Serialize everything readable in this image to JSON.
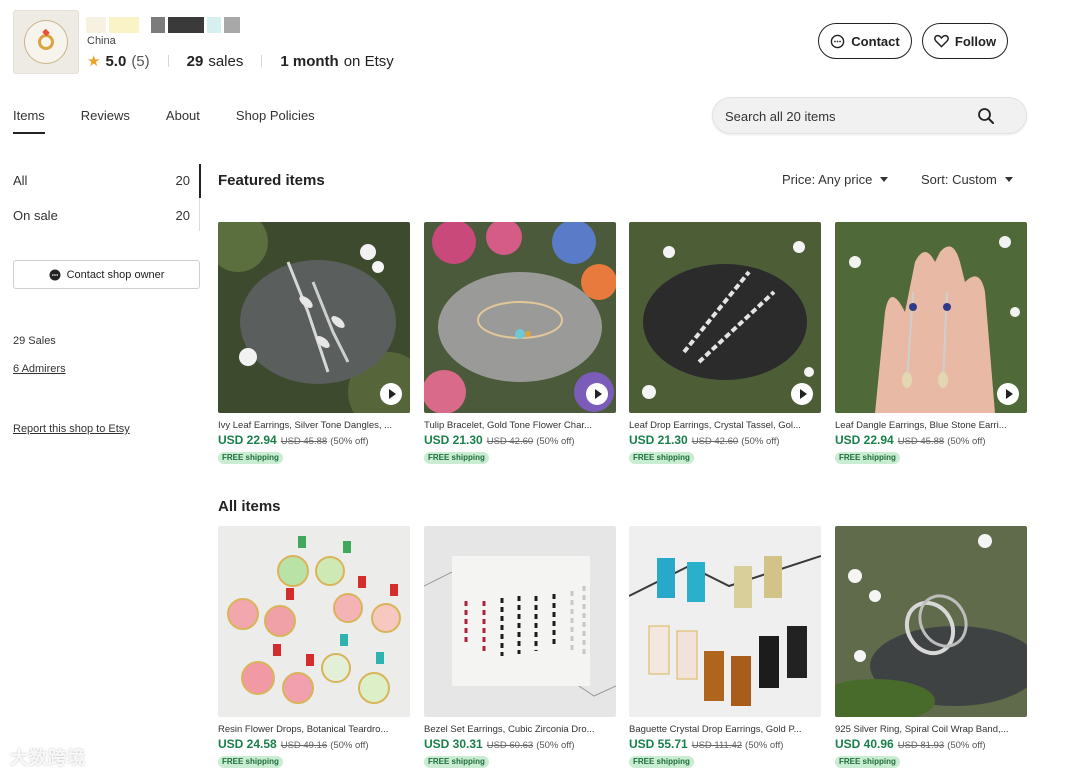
{
  "header": {
    "country": "China",
    "rating": "5.0",
    "rating_count": "(5)",
    "sales_count": "29",
    "sales_label": "sales",
    "tenure_strong": "1 month",
    "tenure_label": "on Etsy",
    "contact_label": "Contact",
    "follow_label": "Follow"
  },
  "tabs": [
    {
      "label": "Items",
      "active": true
    },
    {
      "label": "Reviews",
      "active": false
    },
    {
      "label": "About",
      "active": false
    },
    {
      "label": "Shop Policies",
      "active": false
    }
  ],
  "search": {
    "placeholder": "Search all 20 items"
  },
  "sidebar": {
    "filters": [
      {
        "label": "All",
        "count": "20"
      },
      {
        "label": "On sale",
        "count": "20"
      }
    ],
    "contact_owner_label": "Contact shop owner",
    "sales_text": "29 Sales",
    "admirers_text": "6 Admirers",
    "report_text": "Report this shop to Etsy"
  },
  "featured": {
    "title": "Featured items",
    "price_filter": "Price: Any price",
    "sort": "Sort: Custom",
    "items": [
      {
        "title": "Ivy Leaf Earrings, Silver Tone Dangles, ...",
        "price": "USD 22.94",
        "old_price": "USD 45.88",
        "discount": "(50% off)",
        "badge": "FREE shipping",
        "video": true,
        "image": "silver-leaf-earrings-on-stone"
      },
      {
        "title": "Tulip Bracelet, Gold Tone Flower Char...",
        "price": "USD 21.30",
        "old_price": "USD 42.60",
        "discount": "(50% off)",
        "badge": "FREE shipping",
        "video": true,
        "image": "tulip-bracelet-on-stone"
      },
      {
        "title": "Leaf Drop Earrings, Crystal Tassel, Gol...",
        "price": "USD 21.30",
        "old_price": "USD 42.60",
        "discount": "(50% off)",
        "badge": "FREE shipping",
        "video": true,
        "image": "crystal-leaf-earrings-on-black-stone"
      },
      {
        "title": "Leaf Dangle Earrings, Blue Stone Earri...",
        "price": "USD 22.94",
        "old_price": "USD 45.88",
        "discount": "(50% off)",
        "badge": "FREE shipping",
        "video": true,
        "image": "earrings-in-hand"
      }
    ]
  },
  "all_items": {
    "title": "All items",
    "items": [
      {
        "title": "Resin Flower Drops, Botanical Teardro...",
        "price": "USD 24.58",
        "old_price": "USD 49.16",
        "discount": "(50% off)",
        "badge": "FREE shipping",
        "video": false,
        "image": "resin-flower-earrings"
      },
      {
        "title": "Bezel Set Earrings, Cubic Zirconia Dro...",
        "price": "USD 30.31",
        "old_price": "USD 60.63",
        "discount": "(50% off)",
        "badge": "FREE shipping",
        "video": false,
        "image": "bezel-drop-earrings-display"
      },
      {
        "title": "Baguette Crystal Drop Earrings, Gold P...",
        "price": "USD 55.71",
        "old_price": "USD 111.42",
        "discount": "(50% off)",
        "badge": "FREE shipping",
        "video": false,
        "image": "baguette-crystal-earrings"
      },
      {
        "title": "925 Silver Ring, Spiral Coil Wrap Band,...",
        "price": "USD 40.96",
        "old_price": "USD 81.93",
        "discount": "(50% off)",
        "badge": "FREE shipping",
        "video": false,
        "image": "spiral-silver-ring-on-rock"
      }
    ]
  },
  "colors": {
    "price_green": "#19804a",
    "badge_bg": "#c9ecd2",
    "star": "#e8a32b"
  },
  "watermark": "大数跨境"
}
